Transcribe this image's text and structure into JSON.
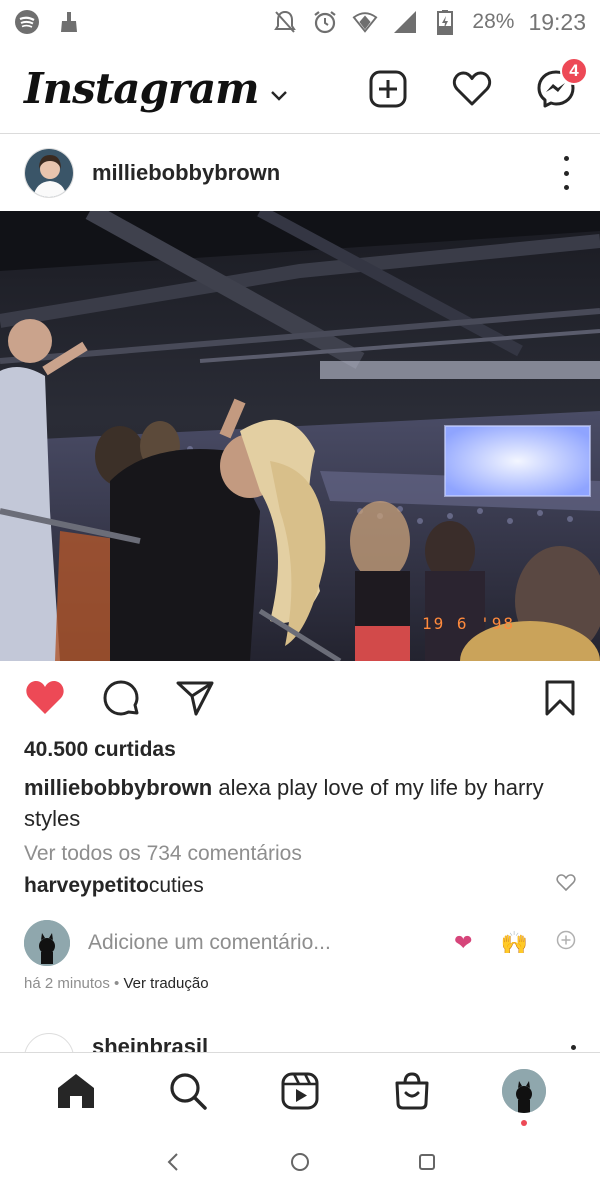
{
  "status_bar": {
    "battery": "28%",
    "time": "19:23",
    "icons": [
      "spotify-icon",
      "broom-icon",
      "mute-icon",
      "alarm-icon",
      "wifi-icon",
      "signal-icon",
      "battery-icon"
    ]
  },
  "header": {
    "logo": "Instagram",
    "messages_badge": "4"
  },
  "post": {
    "username": "milliebobbybrown",
    "photo_stamp": "19 6 '98",
    "likes": "40.500 curtidas",
    "caption_user": "milliebobbybrown",
    "caption_text": " alexa play love of my life by harry styles",
    "view_comments": "Ver todos os 734 comentários",
    "comment_user": "harveypetito",
    "comment_text": " cuties",
    "add_comment_placeholder": "Adicione um comentário...",
    "quick_emojis": [
      "❤",
      "🙌"
    ],
    "time_ago": "há 2 minutos",
    "separator": " • ",
    "translate": "Ver tradução"
  },
  "next_post": {
    "username": "sheinbrasil"
  },
  "colors": {
    "like_red": "#ed4956",
    "text": "#262626",
    "muted": "#8e8e8e"
  }
}
